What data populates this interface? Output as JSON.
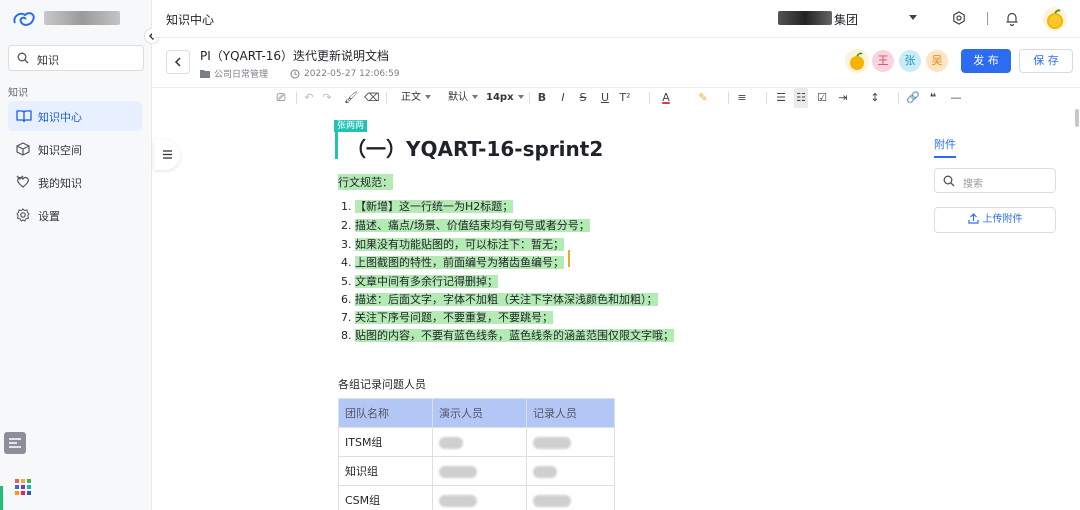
{
  "sidebar": {
    "search_placeholder": "知识",
    "section_label": "知识",
    "items": [
      {
        "label": "知识中心",
        "icon": "book-icon"
      },
      {
        "label": "知识空间",
        "icon": "cube-icon"
      },
      {
        "label": "我的知识",
        "icon": "heart-shield-icon"
      },
      {
        "label": "设置",
        "icon": "gear-icon"
      }
    ]
  },
  "topbar": {
    "title": "知识中心",
    "tenant_suffix": "集团"
  },
  "doc": {
    "title": "PI（YQART-16）迭代更新说明文档",
    "folder": "公司日常管理",
    "timestamp": "2022-05-27 12:06:59",
    "publish_label": "发 布",
    "save_label": "保 存",
    "collaborators": [
      "王",
      "张",
      "吴"
    ]
  },
  "toolbar": {
    "paragraph": "正文",
    "font": "默认",
    "size": "14px"
  },
  "editor": {
    "cursor_user": "张两两",
    "heading": "（一）YQART-16-sprint2",
    "rules_label": "行文规范：",
    "rules": [
      "【新增】这一行统一为H2标题；",
      "描述、痛点/场景、价值结束均有句号或者分号；",
      "如果没有功能贴图的，可以标注下：暂无；",
      "上图截图的特性，前面编号为猪齿鱼编号；",
      "文章中间有多余行记得删掉；",
      "描述：后面文字，字体不加粗（关注下字体深浅颜色和加粗）；",
      "关注下序号问题，不要重复，不要跳号；",
      "贴图的内容，不要有蓝色线条，蓝色线条的涵盖范围仅限文字哦；"
    ],
    "table_title": "各组记录问题人员",
    "table": {
      "headers": [
        "团队名称",
        "演示人员",
        "记录人员"
      ],
      "rows": [
        [
          "ITSM组"
        ],
        [
          "知识组"
        ],
        [
          "CSM组"
        ]
      ]
    }
  },
  "right_panel": {
    "tab": "附件",
    "search_placeholder": "搜索",
    "upload_label": "上传附件"
  },
  "colors": {
    "accent": "#2d6cf0",
    "highlight": "#b4eab4",
    "table_header": "#b3c7f7"
  }
}
